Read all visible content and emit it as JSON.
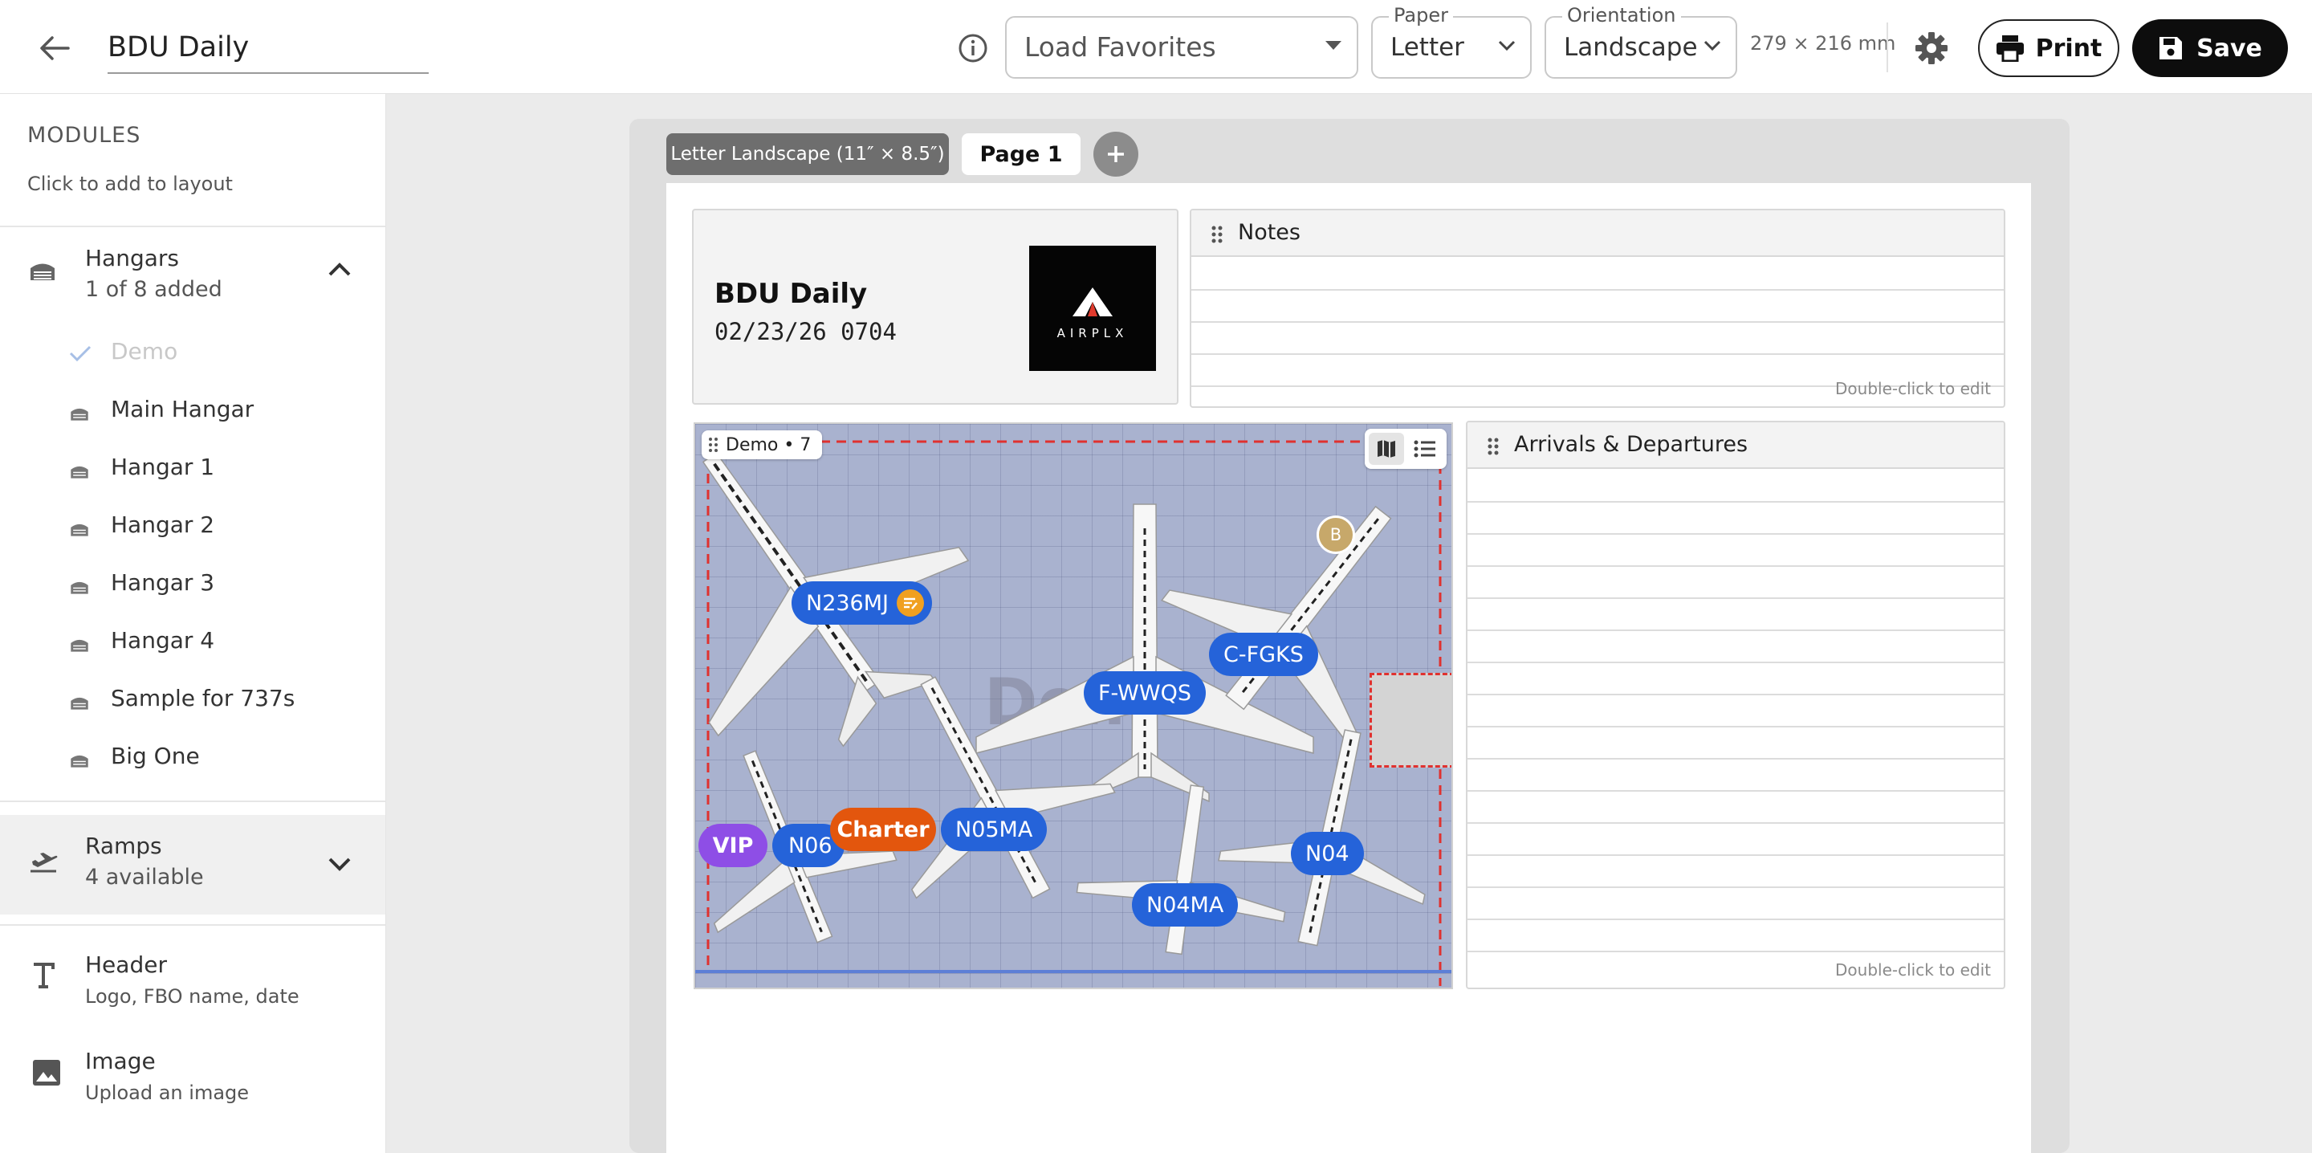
{
  "toolbar": {
    "title": "BDU Daily",
    "favorites_placeholder": "Load Favorites",
    "paper_label": "Paper",
    "paper_value": "Letter",
    "orientation_label": "Orientation",
    "orientation_value": "Landscape",
    "dimensions": "279 × 216 mm",
    "print_label": "Print",
    "save_label": "Save"
  },
  "sidebar": {
    "heading": "MODULES",
    "subheading": "Click to add to layout",
    "hangars": {
      "name": "Hangars",
      "count": "1 of 8 added",
      "items": [
        {
          "label": "Demo",
          "added": true
        },
        {
          "label": "Main Hangar"
        },
        {
          "label": "Hangar 1"
        },
        {
          "label": "Hangar 2"
        },
        {
          "label": "Hangar 3"
        },
        {
          "label": "Hangar 4"
        },
        {
          "label": "Sample for 737s"
        },
        {
          "label": "Big One"
        }
      ]
    },
    "ramps": {
      "name": "Ramps",
      "count": "4 available"
    },
    "header": {
      "name": "Header",
      "desc": "Logo, FBO name, date"
    },
    "image": {
      "name": "Image",
      "desc": "Upload an image"
    }
  },
  "layout": {
    "tab_template": "Letter Landscape (11″ × 8.5″)",
    "tab_page": "Page 1",
    "header_module": {
      "title": "BDU Daily",
      "date": "02/23/26 0704",
      "logo_text": "AIRPLX"
    },
    "notes": {
      "title": "Notes",
      "hint": "Double-click to edit"
    },
    "arrivals": {
      "title": "Arrivals & Departures",
      "hint": "Double-click to edit"
    },
    "hangar_map": {
      "chip": "Demo • 7",
      "watermark": "Dem",
      "marker": "B",
      "aircraft": [
        "N236MJ",
        "C-FGKS",
        "F-WWQS",
        "N05MA",
        "N04",
        "N04MA",
        "N06"
      ],
      "tags": [
        "VIP",
        "Charter"
      ]
    }
  },
  "colors": {
    "accent_blue": "#2563d9",
    "charter_orange": "#e3560d",
    "vip_purple": "#8e4ee6",
    "note_amber": "#f0a020",
    "save_black": "#0d0d0d"
  }
}
